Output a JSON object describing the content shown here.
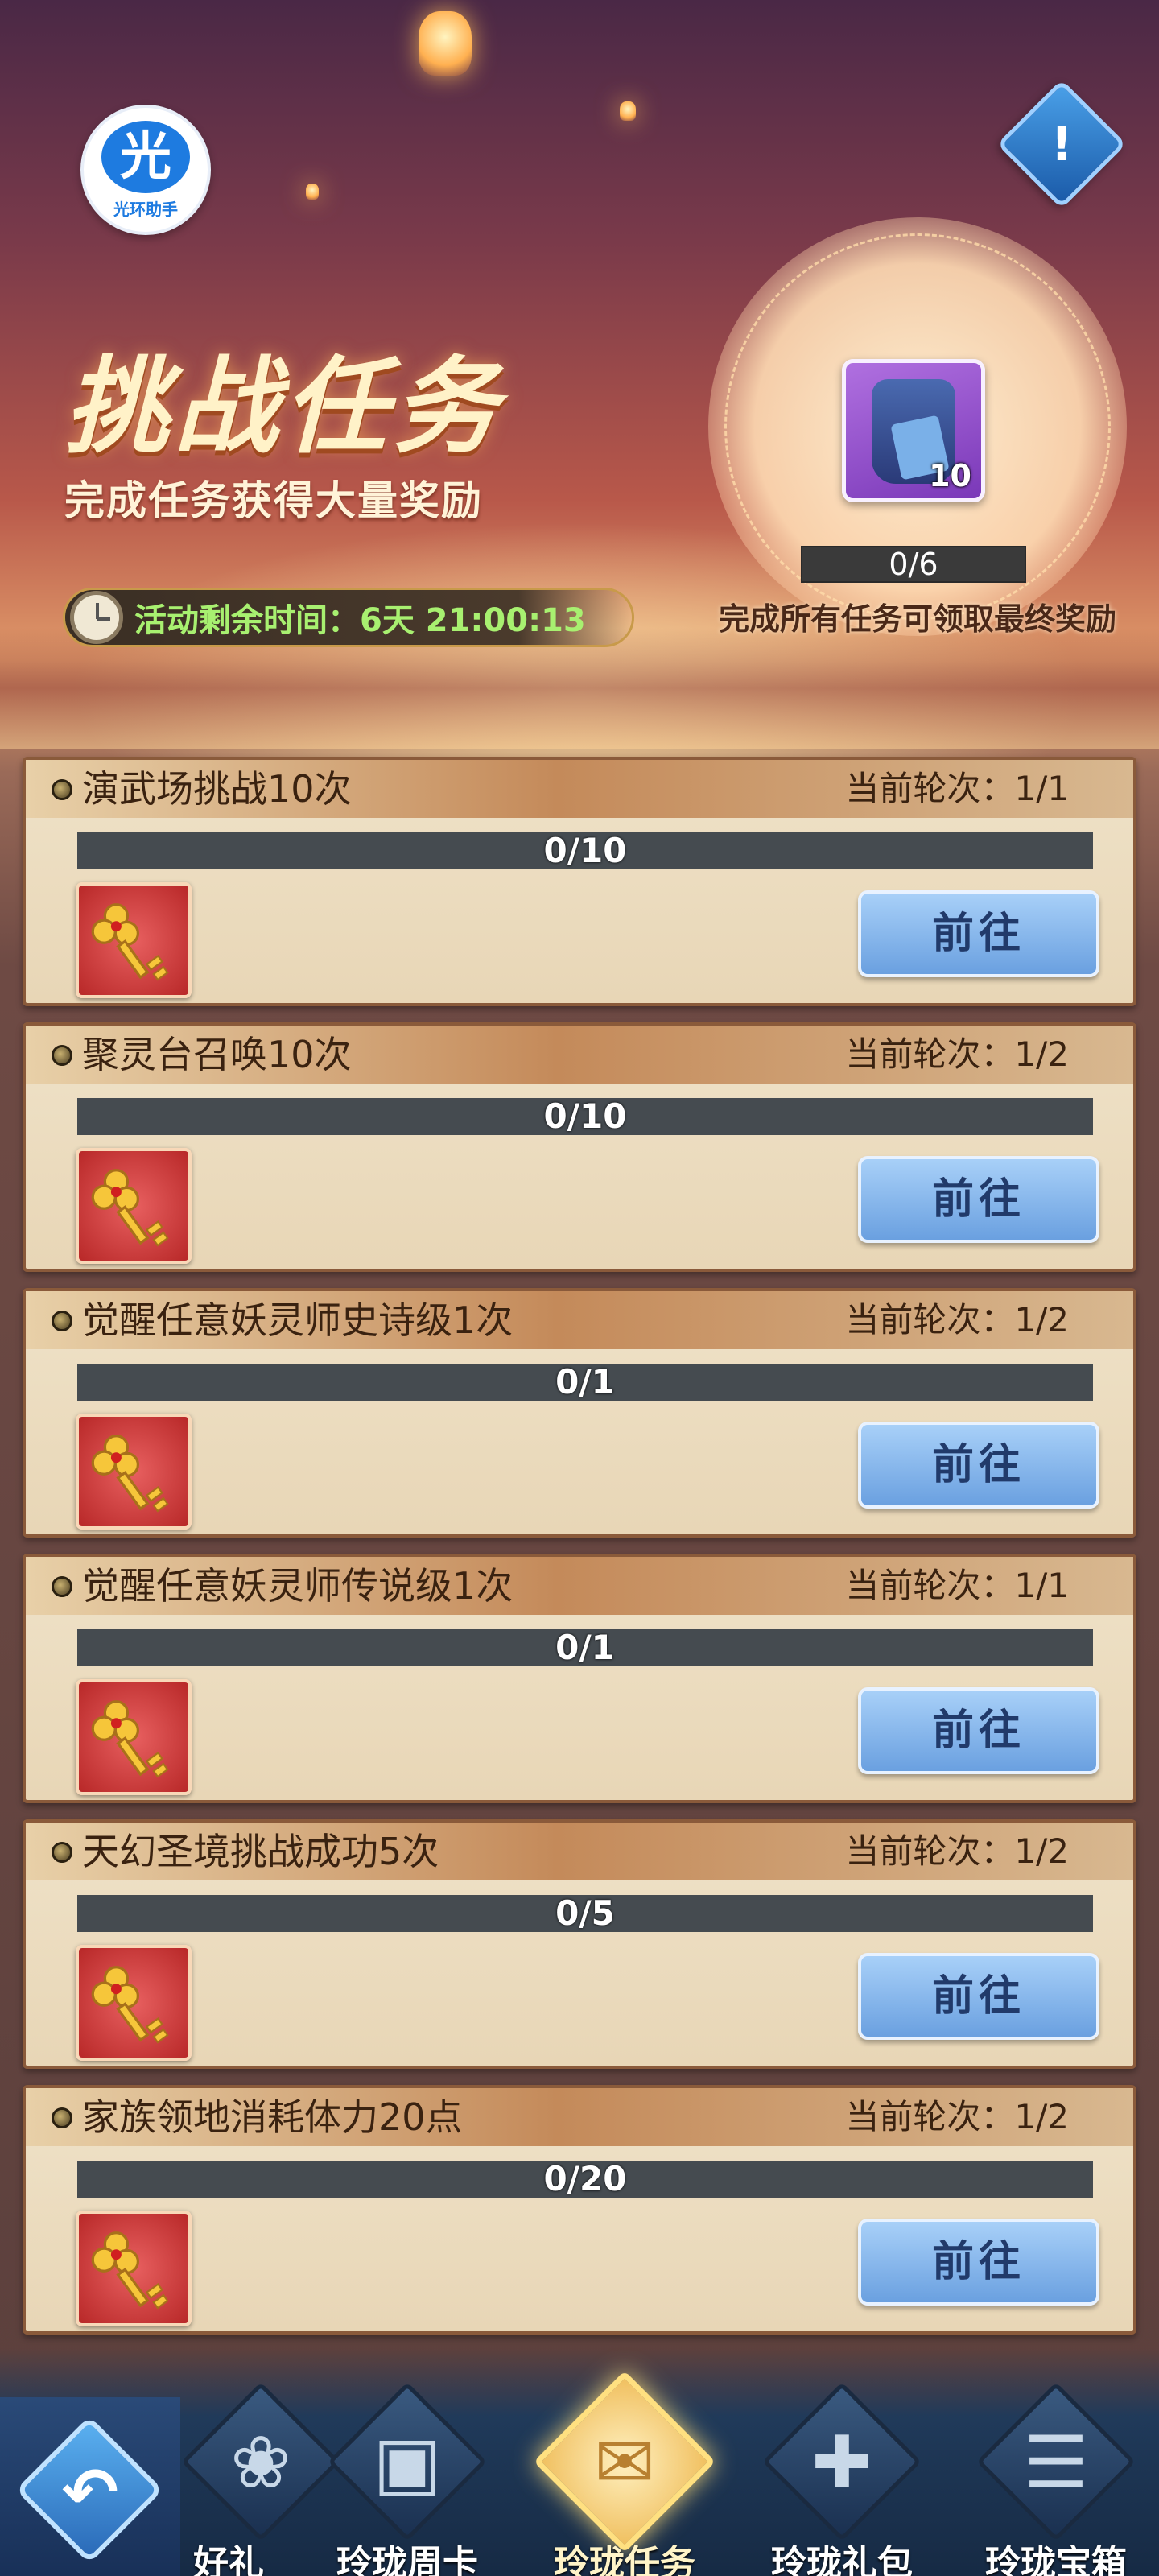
{
  "header": {
    "logo_char": "光",
    "logo_text": "光环助手",
    "info_symbol": "!",
    "title": "挑战任务",
    "subtitle": "完成任务获得大量奖励",
    "timer_text": "活动剩余时间：6天  21:00:13"
  },
  "final_reward": {
    "item_icon": "purple-bag-icon",
    "item_count": "10",
    "progress_label": "0/6",
    "progress_fraction": 0,
    "hint": "完成所有任务可领取最终奖励"
  },
  "tasks": [
    {
      "name": "演武场挑战10次",
      "round": "当前轮次：1/1",
      "progress": "0/10",
      "fraction": 0,
      "reward_icon": "golden-key-icon",
      "button": "前往"
    },
    {
      "name": "聚灵台召唤10次",
      "round": "当前轮次：1/2",
      "progress": "0/10",
      "fraction": 0,
      "reward_icon": "golden-key-icon",
      "button": "前往"
    },
    {
      "name": "觉醒任意妖灵师史诗级1次",
      "round": "当前轮次：1/2",
      "progress": "0/1",
      "fraction": 0,
      "reward_icon": "golden-key-icon",
      "button": "前往"
    },
    {
      "name": "觉醒任意妖灵师传说级1次",
      "round": "当前轮次：1/1",
      "progress": "0/1",
      "fraction": 0,
      "reward_icon": "golden-key-icon",
      "button": "前往"
    },
    {
      "name": "天幻圣境挑战成功5次",
      "round": "当前轮次：1/2",
      "progress": "0/5",
      "fraction": 0,
      "reward_icon": "golden-key-icon",
      "button": "前往"
    },
    {
      "name": "家族领地消耗体力20点",
      "round": "当前轮次：1/2",
      "progress": "0/20",
      "fraction": 0,
      "reward_icon": "golden-key-icon",
      "button": "前往"
    }
  ],
  "bottom_nav": {
    "back_icon": "back-arrow-icon",
    "tabs": [
      {
        "label": "好礼",
        "icon": "gift-scroll-icon",
        "active": false
      },
      {
        "label": "玲珑周卡",
        "icon": "cards-icon",
        "active": false
      },
      {
        "label": "玲珑任务",
        "icon": "scroll-icon",
        "active": true
      },
      {
        "label": "玲珑礼包",
        "icon": "gift-box-icon",
        "active": false
      },
      {
        "label": "玲珑宝箱",
        "icon": "treasure-chest-icon",
        "active": false
      }
    ]
  },
  "colors": {
    "progress_fill": "#7ac850",
    "button_blue": "#6aa0e0",
    "card_border": "#8a5a3a"
  }
}
